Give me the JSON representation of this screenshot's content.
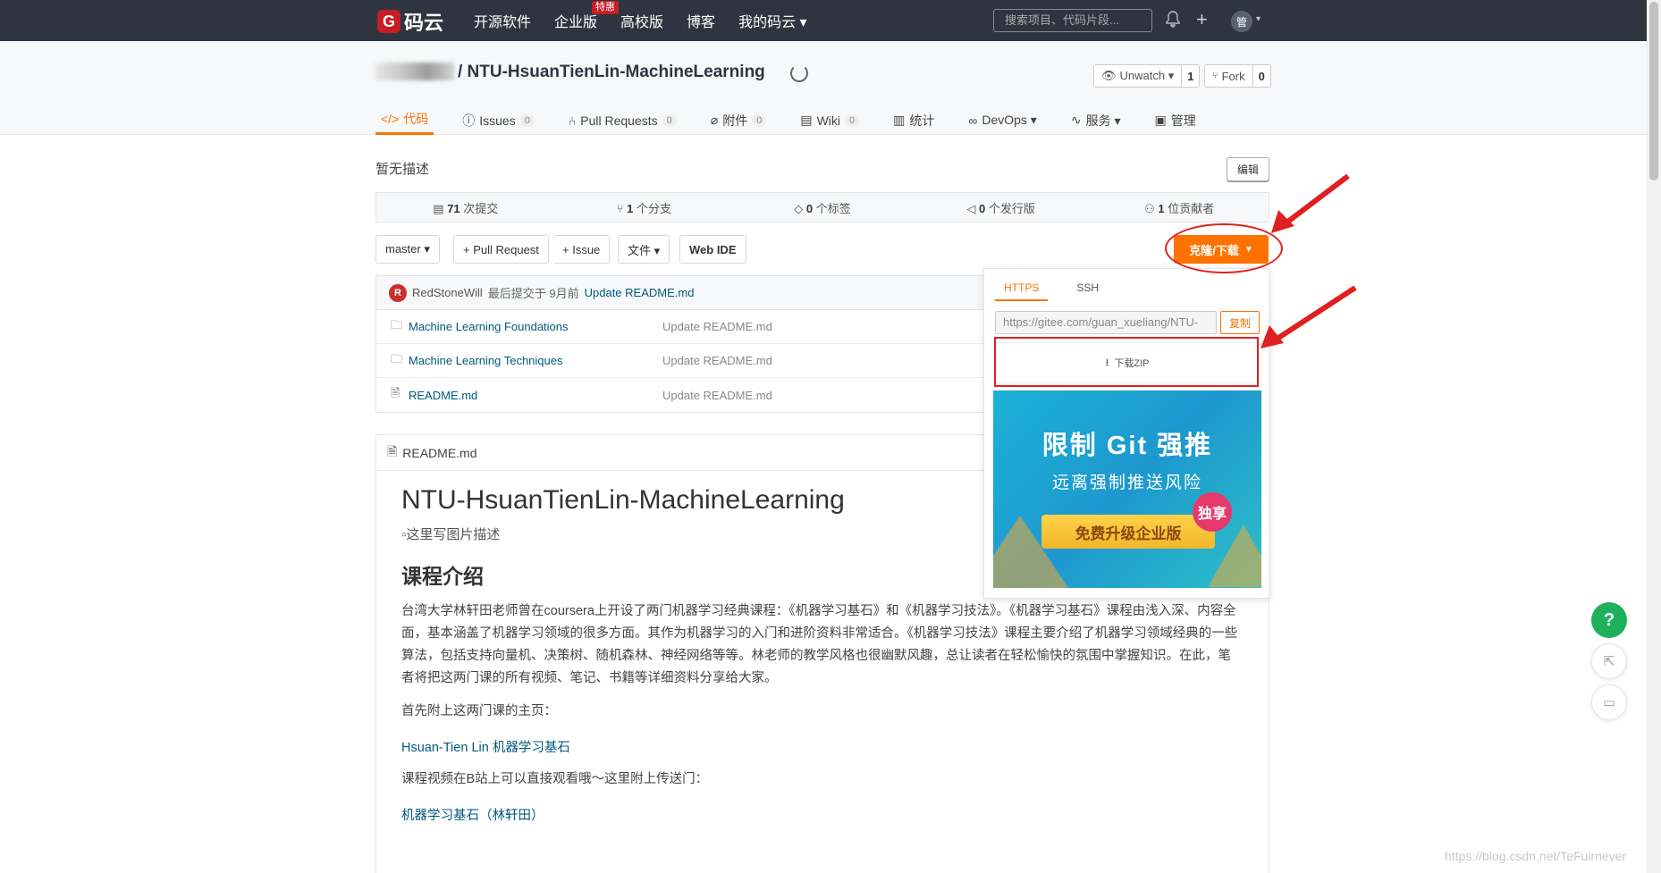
{
  "topnav": {
    "logo_text": "码云",
    "logo_mark": "G",
    "items": [
      {
        "label": "开源软件"
      },
      {
        "label": "企业版",
        "badge": "特惠"
      },
      {
        "label": "高校版"
      },
      {
        "label": "博客"
      },
      {
        "label": "我的码云 ▾"
      }
    ],
    "search_placeholder": "搜索项目、代码片段...",
    "avatar_text": "管"
  },
  "project": {
    "title": "/ NTU-HsuanTienLin-MachineLearning",
    "unwatch_label": "Unwatch ▾",
    "unwatch_count": "1",
    "fork_label": "Fork",
    "fork_count": "0"
  },
  "tabs": [
    {
      "label": "代码",
      "icon": "code-icon"
    },
    {
      "label": "Issues",
      "count": "0",
      "icon": "issue-icon"
    },
    {
      "label": "Pull Requests",
      "count": "0",
      "icon": "pull-request-icon"
    },
    {
      "label": "附件",
      "count": "0",
      "icon": "attachment-icon"
    },
    {
      "label": "Wiki",
      "count": "0",
      "icon": "wiki-icon"
    },
    {
      "label": "统计",
      "icon": "stats-icon"
    },
    {
      "label": "DevOps ▾",
      "icon": "devops-icon"
    },
    {
      "label": "服务 ▾",
      "icon": "service-icon"
    },
    {
      "label": "管理",
      "icon": "manage-icon"
    }
  ],
  "description": "暂无描述",
  "edit_label": "编辑",
  "stats": [
    {
      "num": "71",
      "label": "次提交"
    },
    {
      "num": "1",
      "label": "个分支"
    },
    {
      "num": "0",
      "label": "个标签"
    },
    {
      "num": "0",
      "label": "个发行版"
    },
    {
      "num": "1",
      "label": "位贡献者"
    }
  ],
  "toolbar": {
    "branch": "master ▾",
    "pull_request": "+ Pull Request",
    "issue": "+ Issue",
    "file": "文件 ▾",
    "web_ide": "Web IDE",
    "clone": "克隆/下载"
  },
  "commit": {
    "avatar": "R",
    "author": "RedStoneWill",
    "meta": "最后提交于 9月前",
    "message": "Update README.md"
  },
  "files": [
    {
      "name": "Machine Learning Foundations",
      "msg": "Update README.md",
      "type": "folder"
    },
    {
      "name": "Machine Learning Techniques",
      "msg": "Update README.md",
      "type": "folder"
    },
    {
      "name": "README.md",
      "msg": "Update README.md",
      "type": "file"
    }
  ],
  "clone_panel": {
    "tab_https": "HTTPS",
    "tab_ssh": "SSH",
    "url": "https://gitee.com/guan_xueliang/NTU-",
    "copy": "复制",
    "zip": "下载ZIP",
    "ad_title": "限制 Git 强推",
    "ad_sub": "远离强制推送风险",
    "ad_btn": "免费升级企业版",
    "ad_badge": "独享"
  },
  "readme": {
    "filename": "README.md",
    "h1": "NTU-HsuanTienLin-MachineLearning",
    "img_alt": "这里写图片描述",
    "h2": "课程介绍",
    "p1": "台湾大学林轩田老师曾在coursera上开设了两门机器学习经典课程：《机器学习基石》和《机器学习技法》。《机器学习基石》课程由浅入深、内容全面，基本涵盖了机器学习领域的很多方面。其作为机器学习的入门和进阶资料非常适合。《机器学习技法》课程主要介绍了机器学习领域经典的一些算法，包括支持向量机、决策树、随机森林、神经网络等等。林老师的教学风格也很幽默风趣，总让读者在轻松愉快的氛围中掌握知识。在此，笔者将把这两门课的所有视频、笔记、书籍等详细资料分享给大家。",
    "p2": "首先附上这两门课的主页：",
    "link1": "Hsuan-Tien Lin 机器学习基石",
    "p3": "课程视频在B站上可以直接观看哦～这里附上传送门：",
    "link2": "机器学习基石（林轩田）"
  },
  "float": {
    "help": "?"
  },
  "watermark": "https://blog.csdn.net/TeFuirnever",
  "colors": {
    "accent": "#fe7300",
    "nav_bg": "#2f3540",
    "link": "#005980",
    "annotation": "#e02020"
  }
}
